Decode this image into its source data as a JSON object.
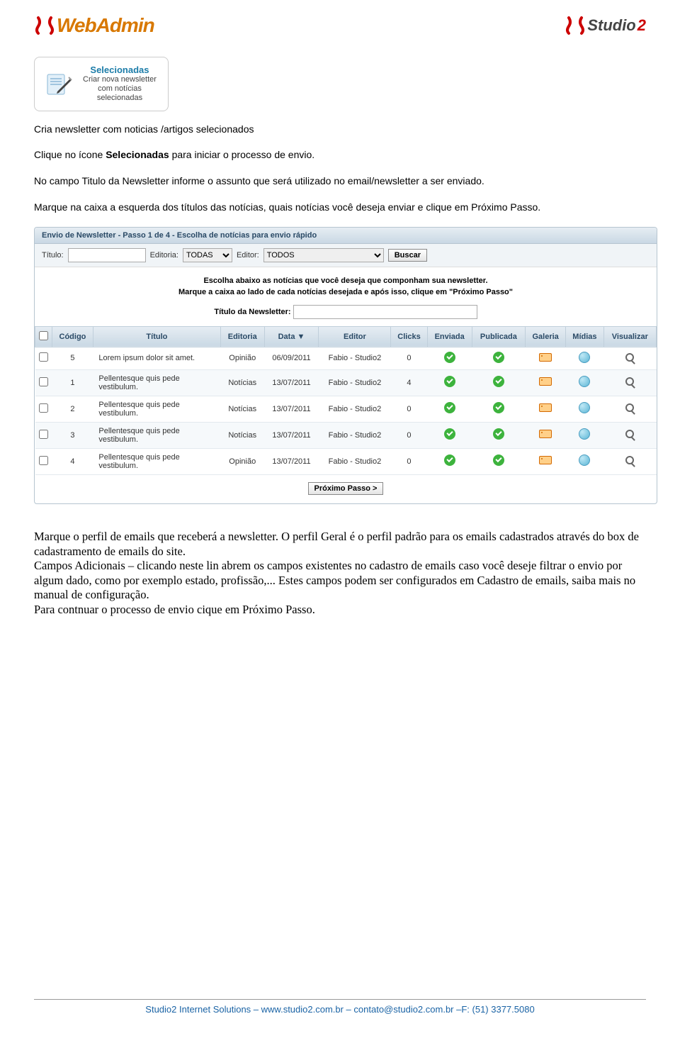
{
  "header": {
    "logo_left": "WebAdmin",
    "logo_right_a": "Studio",
    "logo_right_b": "2"
  },
  "card": {
    "title": "Selecionadas",
    "line1": "Criar nova newsletter",
    "line2": "com notícias",
    "line3": "selecionadas"
  },
  "text": {
    "intro1": "Cria newsletter com noticias /artigos  selecionados",
    "intro2a": "Clique no ícone ",
    "intro2b": "Selecionadas",
    "intro2c": " para iniciar o processo de envio.",
    "intro3": "No campo Titulo da Newsletter informe o assunto que será utilizado no email/newsletter a ser enviado.",
    "intro4": "Marque na caixa a esquerda dos títulos das notícias, quais notícias você deseja enviar e clique em Próximo Passo."
  },
  "panel": {
    "header": "Envio de Newsletter - Passo 1 de 4 - Escolha de notícias para envio rápido",
    "filters": {
      "titulo_label": "Título:",
      "editoria_label": "Editoria:",
      "editoria_value": "TODAS",
      "editor_label": "Editor:",
      "editor_value": "TODOS",
      "buscar": "Buscar"
    },
    "msg1": "Escolha abaixo as notícias que você deseja que componham sua newsletter.",
    "msg2": "Marque a caixa ao lado de cada notícias desejada e após isso, clique em \"Próximo Passo\"",
    "titlefield_label": "Título da Newsletter:",
    "columns": [
      "",
      "Código",
      "Título",
      "Editoria",
      "Data ▼",
      "Editor",
      "Clicks",
      "Enviada",
      "Publicada",
      "Galeria",
      "Mídias",
      "Visualizar"
    ],
    "rows": [
      {
        "codigo": "5",
        "titulo": "Lorem ipsum dolor sit amet.",
        "editoria": "Opinião",
        "data": "06/09/2011",
        "editor": "Fabio - Studio2",
        "clicks": "0"
      },
      {
        "codigo": "1",
        "titulo": "Pellentesque quis pede vestibulum.",
        "editoria": "Notícias",
        "data": "13/07/2011",
        "editor": "Fabio - Studio2",
        "clicks": "4"
      },
      {
        "codigo": "2",
        "titulo": "Pellentesque quis pede vestibulum.",
        "editoria": "Notícias",
        "data": "13/07/2011",
        "editor": "Fabio - Studio2",
        "clicks": "0"
      },
      {
        "codigo": "3",
        "titulo": "Pellentesque quis pede vestibulum.",
        "editoria": "Notícias",
        "data": "13/07/2011",
        "editor": "Fabio - Studio2",
        "clicks": "0"
      },
      {
        "codigo": "4",
        "titulo": "Pellentesque quis pede vestibulum.",
        "editoria": "Opinião",
        "data": "13/07/2011",
        "editor": "Fabio - Studio2",
        "clicks": "0"
      }
    ],
    "next": "Próximo Passo >"
  },
  "body2": {
    "p1": "Marque o perfil de emails que receberá a newsletter. O perfil Geral é o perfil padrão para os emails cadastrados através do box de cadastramento de emails do site.",
    "p2": "Campos Adicionais – clicando neste lin abrem os campos existentes no cadastro de emails caso você deseje filtrar o envio por algum dado, como por exemplo estado, profissão,... Estes campos podem ser configurados em Cadastro de emails, saiba mais no manual de configuração.",
    "p3": "Para contnuar o processo de envio cique em Próximo Passo."
  },
  "footer": "Studio2 Internet Solutions – www.studio2.com.br – contato@studio2.com.br –F: (51) 3377.5080"
}
